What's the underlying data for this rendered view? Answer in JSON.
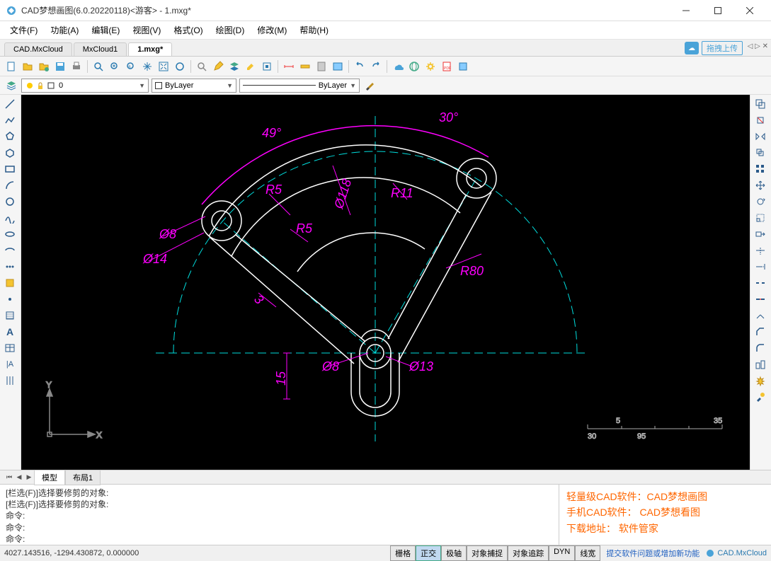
{
  "window": {
    "title": "CAD梦想画图(6.0.20220118)<游客> - 1.mxg*"
  },
  "menu": {
    "items": [
      "文件(F)",
      "功能(A)",
      "编辑(E)",
      "视图(V)",
      "格式(O)",
      "绘图(D)",
      "修改(M)",
      "帮助(H)"
    ]
  },
  "file_tabs": {
    "tabs": [
      {
        "label": "CAD.MxCloud",
        "active": false
      },
      {
        "label": "MxCloud1",
        "active": false
      },
      {
        "label": "1.mxg*",
        "active": true
      }
    ],
    "upload_label": "拖拽上传"
  },
  "layer_bar": {
    "layer": "0",
    "color": "ByLayer",
    "linetype": "ByLayer"
  },
  "drawing": {
    "angles": {
      "left": "49°",
      "right": "30°"
    },
    "dims": {
      "r5a": "R5",
      "r5b": "R5",
      "r11": "R11",
      "r80": "R80",
      "d8a": "Ø8",
      "d14": "Ø14",
      "d118": "Ø118",
      "d8b": "Ø8",
      "d13": "Ø13",
      "v15": "15",
      "r3": "3"
    },
    "axis": {
      "x": "X",
      "y": "Y"
    },
    "scale": {
      "s5": "5",
      "s35": "35",
      "s30": "30",
      "s95": "95"
    }
  },
  "bottom_tabs": {
    "model": "模型",
    "layout": "布局1"
  },
  "command": {
    "line1": "[栏选(F)]选择要修剪的对象:",
    "line2": "[栏选(F)]选择要修剪的对象:",
    "line3": "命令:",
    "line4": "命令:",
    "line5": "命令:"
  },
  "promo": {
    "l1": "轻量级CAD软件：CAD梦想画图",
    "l2": "手机CAD软件： CAD梦想看图",
    "l3": "下载地址：   软件管家"
  },
  "status": {
    "coords": "4027.143516,  -1294.430872,  0.000000",
    "btns": [
      "栅格",
      "正交",
      "极轴",
      "对象捕捉",
      "对象追踪",
      "DYN",
      "线宽"
    ],
    "link": "提交软件问题或增加新功能",
    "brand": "CAD.MxCloud"
  }
}
